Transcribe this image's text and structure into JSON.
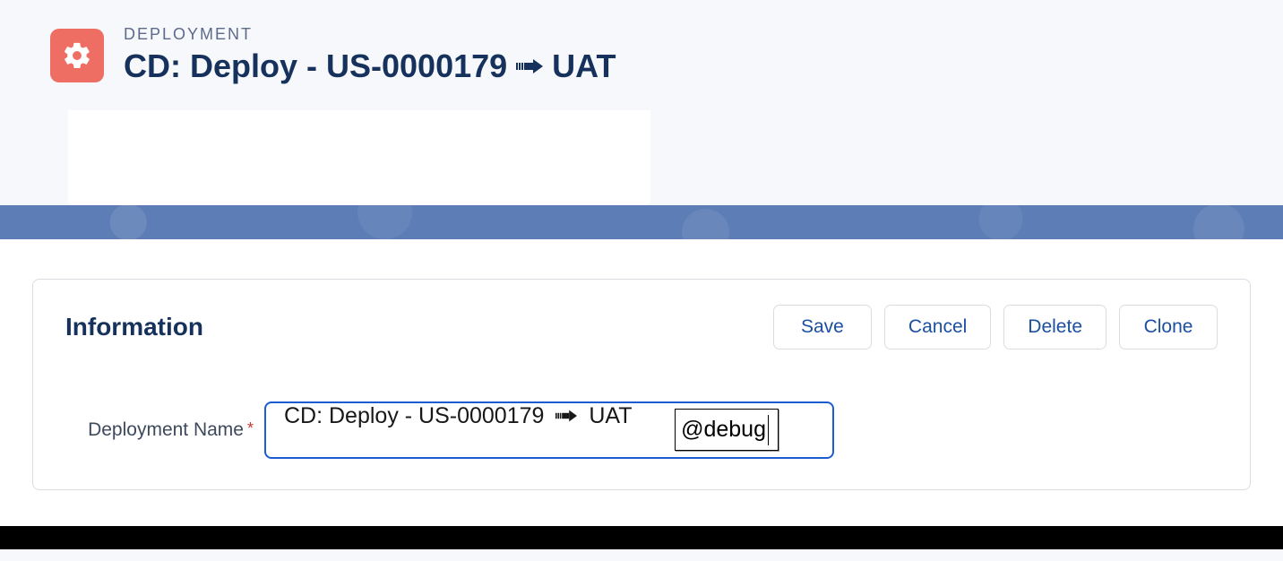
{
  "header": {
    "object_label": "DEPLOYMENT",
    "title_prefix": "CD: Deploy - US-0000179",
    "title_suffix": "UAT"
  },
  "panel": {
    "section_title": "Information",
    "actions": {
      "save": "Save",
      "cancel": "Cancel",
      "delete": "Delete",
      "clone": "Clone"
    }
  },
  "field": {
    "label": "Deployment Name",
    "value_prefix": "CD: Deploy - US-0000179",
    "value_suffix": "UAT",
    "ime_text": "@debug"
  }
}
